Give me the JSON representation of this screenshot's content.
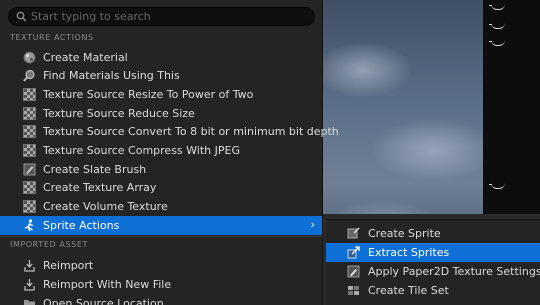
{
  "search": {
    "placeholder": "Start typing to search"
  },
  "sections": {
    "texture_actions": "TEXTURE ACTIONS",
    "imported_asset": "IMPORTED ASSET"
  },
  "menu": {
    "items": [
      {
        "label": "Create Material",
        "icon": "material-sphere-icon"
      },
      {
        "label": "Find Materials Using This",
        "icon": "magnifier-icon"
      },
      {
        "label": "Texture Source Resize To Power of Two",
        "icon": "checker-texture-icon"
      },
      {
        "label": "Texture Source Reduce Size",
        "icon": "checker-texture-icon"
      },
      {
        "label": "Texture Source Convert To 8 bit or minimum bit depth",
        "icon": "checker-texture-icon"
      },
      {
        "label": "Texture Source Compress With JPEG",
        "icon": "checker-texture-icon"
      },
      {
        "label": "Create Slate Brush",
        "icon": "brush-icon"
      },
      {
        "label": "Create Texture Array",
        "icon": "checker-texture-icon"
      },
      {
        "label": "Create Volume Texture",
        "icon": "checker-texture-icon"
      },
      {
        "label": "Sprite Actions",
        "icon": "sprite-character-icon",
        "submenu_arrow": "›"
      }
    ],
    "imported_items": [
      {
        "label": "Reimport",
        "icon": "reimport-icon"
      },
      {
        "label": "Reimport With New File",
        "icon": "reimport-icon"
      },
      {
        "label": "Open Source Location",
        "icon": "folder-icon"
      }
    ]
  },
  "submenu": {
    "items": [
      {
        "label": "Create Sprite",
        "icon": "sprite-icon"
      },
      {
        "label": "Extract Sprites",
        "icon": "extract-sprites-icon"
      },
      {
        "label": "Apply Paper2D Texture Settings",
        "icon": "paper2d-settings-icon"
      },
      {
        "label": "Create Tile Set",
        "icon": "tile-set-icon"
      }
    ]
  },
  "colors": {
    "menu_bg": "#242424",
    "highlight": "#0e70d6",
    "text": "#dcdcdc",
    "section_text": "#8a8a8a"
  }
}
